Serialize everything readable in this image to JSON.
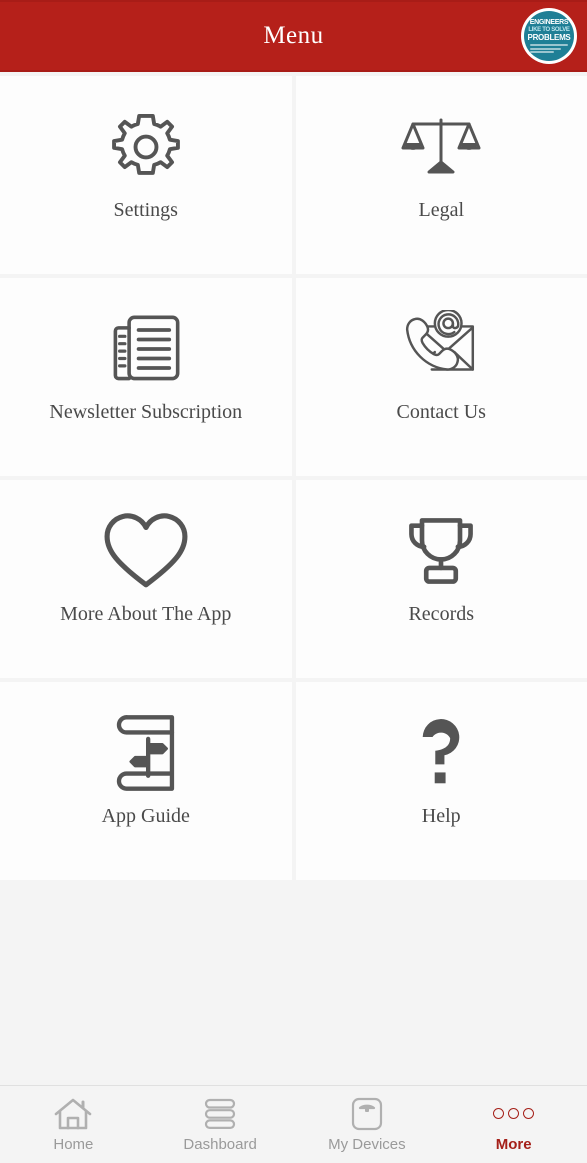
{
  "header": {
    "title": "Menu",
    "logo": {
      "name": "engineers-badge-logo",
      "line1": "ENGINEERS",
      "line2": "LIKE TO SOLVE",
      "line3": "PROBLEMS",
      "background_color": "#1f7f96"
    },
    "background_color": "#b5201a",
    "title_color": "#ffffff"
  },
  "menu": {
    "tiles": [
      {
        "label": "Settings",
        "icon": "gear-icon"
      },
      {
        "label": "Legal",
        "icon": "balance-scale-icon"
      },
      {
        "label": "Newsletter Subscription",
        "icon": "newspaper-icon"
      },
      {
        "label": "Contact Us",
        "icon": "envelope-phone-at-icon"
      },
      {
        "label": "More About The App",
        "icon": "heart-icon"
      },
      {
        "label": "Records",
        "icon": "trophy-icon"
      },
      {
        "label": "App Guide",
        "icon": "book-signpost-icon"
      },
      {
        "label": "Help",
        "icon": "question-mark-icon"
      }
    ],
    "tile_background_color": "#fdfdfd",
    "label_color": "#4a4a4a",
    "icon_color": "#555555",
    "page_background_color": "#f4f4f4"
  },
  "bottom_nav": {
    "items": [
      {
        "label": "Home",
        "icon": "house-icon",
        "active": false
      },
      {
        "label": "Dashboard",
        "icon": "stacked-bars-icon",
        "active": false
      },
      {
        "label": "My Devices",
        "icon": "weight-scale-icon",
        "active": false
      },
      {
        "label": "More",
        "icon": "three-dots-icon",
        "active": true
      }
    ],
    "inactive_color": "#9a9a9a",
    "active_color": "#a52019"
  }
}
